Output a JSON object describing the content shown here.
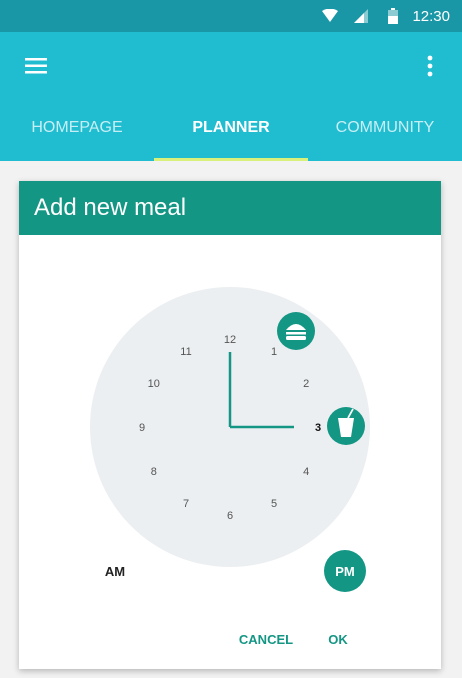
{
  "status_bar": {
    "time": "12:30",
    "icons": [
      "wifi-icon",
      "signal-icon",
      "battery-icon"
    ]
  },
  "app_bar": {
    "menu_icon": "menu-icon",
    "more_icon": "more-vert-icon",
    "tabs": [
      {
        "label": "HOMEPAGE",
        "active": false
      },
      {
        "label": "PLANNER",
        "active": true
      },
      {
        "label": "COMMUNITY",
        "active": false
      }
    ]
  },
  "dialog": {
    "title": "Add new meal",
    "selected_hour": "3",
    "selected_minute": "00",
    "hours": [
      "12",
      "1",
      "2",
      "3",
      "4",
      "5",
      "6",
      "7",
      "8",
      "9",
      "10",
      "11"
    ],
    "meal_markers": [
      {
        "hour": "1",
        "icon": "burger-icon"
      },
      {
        "hour": "3",
        "icon": "drink-icon"
      }
    ],
    "am_label": "AM",
    "pm_label": "PM",
    "period_selected": "PM",
    "cancel_label": "CANCEL",
    "ok_label": "OK"
  },
  "colors": {
    "status_bar": "#1a97a6",
    "app_bar": "#20bdd1",
    "tab_indicator": "#d9f07a",
    "accent": "#149684",
    "clock_face": "#eceff1"
  }
}
